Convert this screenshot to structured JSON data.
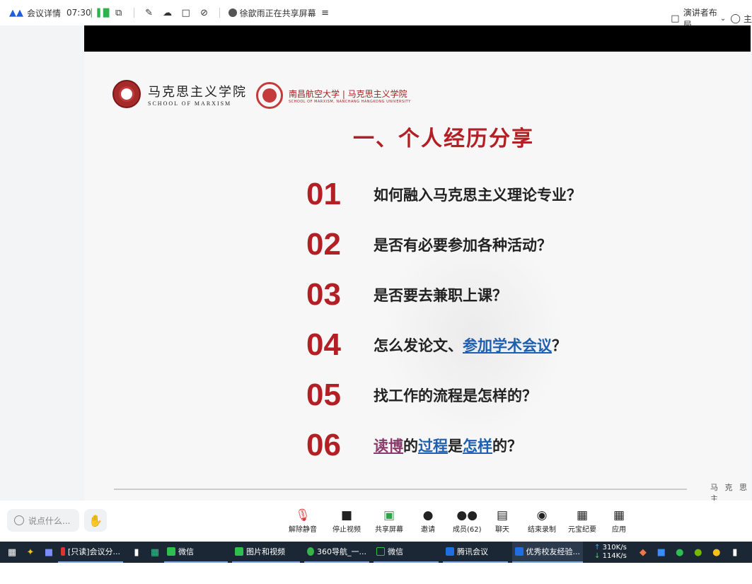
{
  "topbar": {
    "meeting_details": "会议详情",
    "elapsed": "07:30",
    "sharer_status": "徐歆雨正在共享屏幕",
    "speaker_layout": "演讲者布局",
    "right_cut_text": "主"
  },
  "slide": {
    "logo1_cn": "马克思主义学院",
    "logo1_en": "SCHOOL OF MARXISM",
    "logo2_cn": "南昌航空大学 | 马克思主义学院",
    "logo2_en": "SCHOOL OF MARXISM, NANCHANG HANGKONG UNIVERSITY",
    "title": "一、个人经历分享",
    "items": [
      {
        "num": "01",
        "text": "如何融入马克思主义理论专业？"
      },
      {
        "num": "02",
        "text": "是否有必要参加各种活动？"
      },
      {
        "num": "03",
        "text": "是否要去兼职上课？"
      },
      {
        "num": "04",
        "text_a": "怎么发论文、",
        "text_link": "参加学术会议",
        "text_b": "？"
      },
      {
        "num": "05",
        "text": "找工作的流程是怎样的？"
      },
      {
        "num": "06",
        "link1": "读博",
        "t1": "的",
        "link2": "过程",
        "t2": "是",
        "link3": "怎样",
        "t3": "的？"
      }
    ],
    "footer": "马 克 思 主"
  },
  "bottombar": {
    "say_placeholder": "说点什么...",
    "controls": {
      "unmute": "解除静音",
      "stop_video": "停止视频",
      "share_screen": "共享屏幕",
      "invite": "邀请",
      "members": "成员(62)",
      "chat": "聊天",
      "end_record": "结束录制",
      "yuanbao": "元宝纪要",
      "apps": "应用"
    }
  },
  "taskbar": {
    "tasks": [
      "[只读]会议分...",
      "微信",
      "图片和视频",
      "360导航_一...",
      "微信",
      "腾讯会议",
      "优秀校友经验..."
    ],
    "net_up": "310K/s",
    "net_down": "114K/s"
  },
  "colors": {
    "accent_red": "#b21f24",
    "link_blue": "#1f5fb0",
    "link_purple": "#8a3a6b"
  }
}
